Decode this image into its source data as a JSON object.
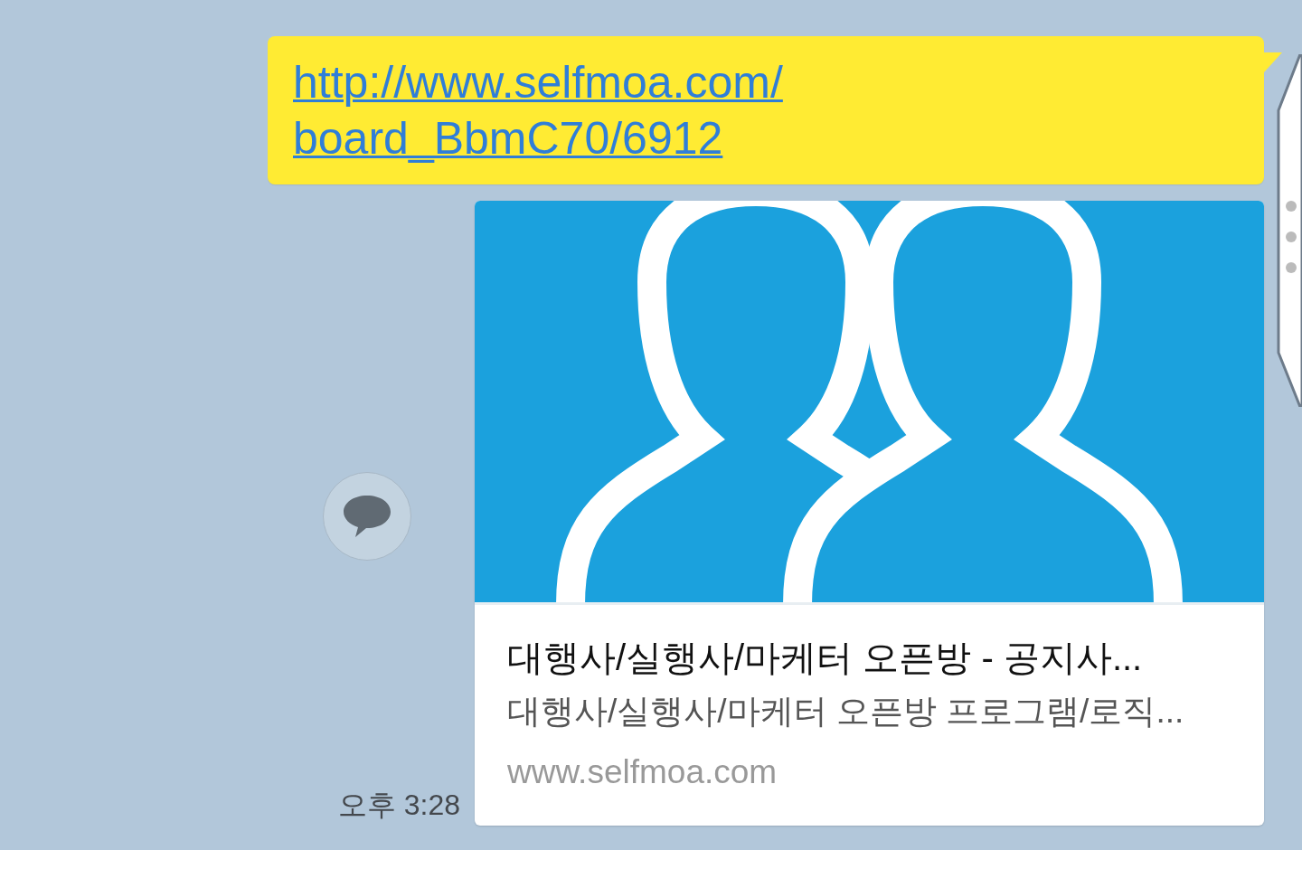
{
  "message": {
    "link_lines": [
      "http://www.selfmoa.com/",
      "board_BbmC70/6912"
    ]
  },
  "share_button": {
    "kind": "share"
  },
  "time": "오후 3:28",
  "preview": {
    "title": "대행사/실행사/마케터 오픈방 - 공지사...",
    "description": "대행사/실행사/마케터 오픈방 프로그램/로직...",
    "domain": "www.selfmoa.com"
  },
  "side_handle": {
    "kind": "handle"
  }
}
